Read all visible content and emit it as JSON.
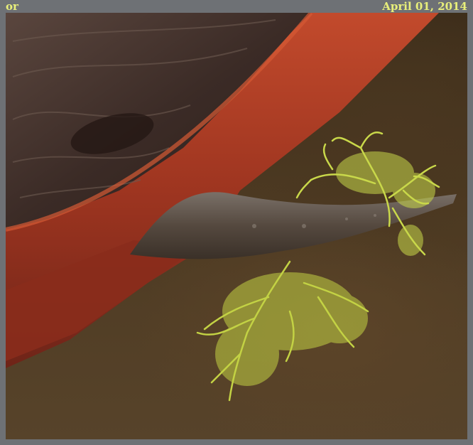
{
  "caption": {
    "left_text": "or",
    "date": "April 01, 2014"
  },
  "photo": {
    "subject": "lichen-on-branch",
    "colors": {
      "background": "#4d3a22",
      "bark_red": "#a33a22",
      "wood_dark": "#3a2a22",
      "twig": "#5a5048",
      "lichen": "#c9d84a"
    }
  }
}
